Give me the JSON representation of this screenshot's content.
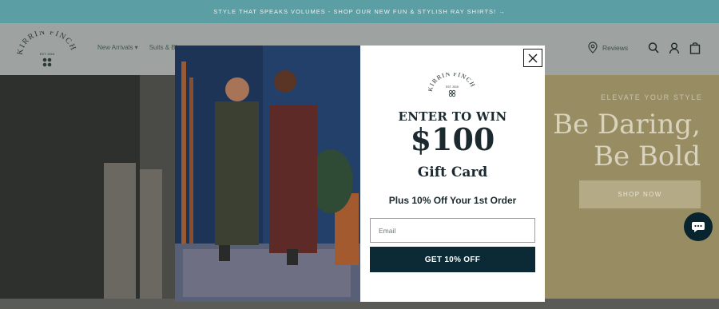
{
  "announcement": {
    "text": "STYLE THAT SPEAKS VOLUMES - SHOP OUR NEW FUN & STYLISH RAY SHIRTS! →"
  },
  "header": {
    "logo": {
      "brand": "KIRRIN FINCH",
      "est": "EST. 2015"
    },
    "nav": [
      {
        "label": "New Arrivals ▾"
      },
      {
        "label": "Suits & Bl"
      }
    ],
    "reviews_label": "Reviews",
    "icons": [
      "location-pin-icon",
      "search-icon",
      "account-icon",
      "cart-icon"
    ]
  },
  "hero": {
    "eyebrow": "ELEVATE YOUR STYLE",
    "headline_line1": "Be Daring,",
    "headline_line2": "Be Bold",
    "button_label": "SHOP NOW"
  },
  "modal": {
    "logo": {
      "brand": "KIRRIN FINCH",
      "est": "EST. 2015"
    },
    "heading": "ENTER TO WIN",
    "amount": "$100",
    "subheading": "Gift Card",
    "offer": "Plus 10% Off Your 1st Order",
    "email": {
      "placeholder": "Email",
      "value": ""
    },
    "cta_label": "GET 10% OFF",
    "close_icon": "close-icon"
  },
  "chat_icon": "chat-icon",
  "colors": {
    "announcement_bg": "#5b9ea3",
    "cta_bg": "#0c2a35",
    "modal_text": "#1c2a2f",
    "overlay": "rgba(0,0,0,0.38)"
  }
}
